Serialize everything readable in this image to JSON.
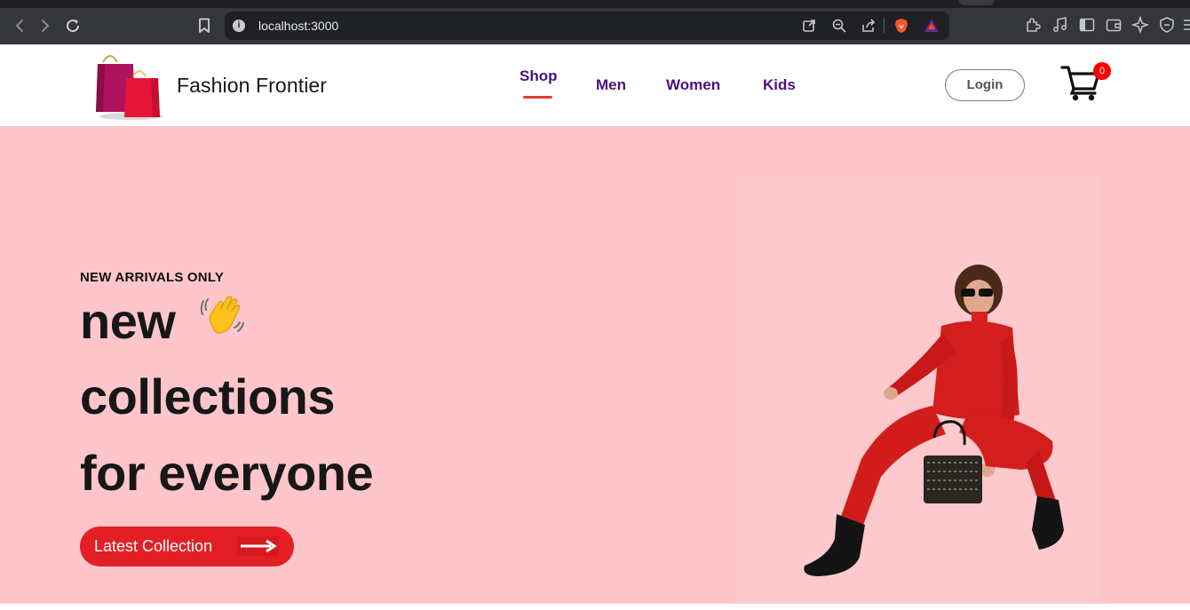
{
  "browser": {
    "url": "localhost:3000"
  },
  "site": {
    "brand": "Fashion Frontier",
    "nav": [
      {
        "label": "Shop",
        "active": true
      },
      {
        "label": "Men",
        "active": false
      },
      {
        "label": "Women",
        "active": false
      },
      {
        "label": "Kids",
        "active": false
      }
    ],
    "login_label": "Login",
    "cart_count": "0"
  },
  "hero": {
    "eyebrow": "NEW ARRIVALS ONLY",
    "line1": "new",
    "line2": "collections",
    "line3": "for everyone",
    "cta_label": "Latest Collection"
  },
  "colors": {
    "hero_bg": "#fec6ca",
    "accent_red": "#e31f25",
    "nav_purple": "#4a1080",
    "badge_red": "#ff0000"
  },
  "icons": [
    "back-icon",
    "forward-icon",
    "reload-icon",
    "bookmark-icon",
    "info-icon",
    "open-external-icon",
    "zoom-icon",
    "share-icon",
    "brave-shield-icon",
    "bat-rewards-icon",
    "extensions-icon",
    "media-icon",
    "sidebar-icon",
    "wallet-icon",
    "leo-ai-icon",
    "vpn-icon",
    "cart-icon",
    "waving-hand-icon",
    "arrow-right-icon"
  ]
}
